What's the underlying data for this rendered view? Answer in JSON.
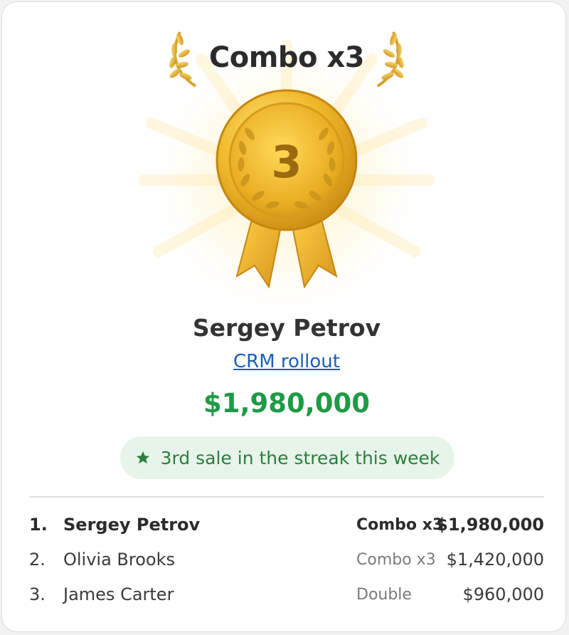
{
  "award": {
    "title": "Combo x3",
    "medal_number": "3",
    "winner_name": "Sergey Petrov",
    "project_link": "CRM rollout",
    "amount": "$1,980,000",
    "streak_message": "3rd sale in the streak this week"
  },
  "colors": {
    "accent_green": "#1f9a47",
    "pill_background": "#e7f4ea",
    "link_blue": "#1a5fb4",
    "gold": "#e7b52a"
  },
  "icons": {
    "medal": "gold-medal-icon",
    "laurel_left": "laurel-left-icon",
    "laurel_right": "laurel-right-icon",
    "star": "star-icon"
  },
  "leaderboard": [
    {
      "rank": "1.",
      "name": "Sergey Petrov",
      "type": "Combo x3",
      "value": "$1,980,000"
    },
    {
      "rank": "2.",
      "name": "Olivia Brooks",
      "type": "Combo x3",
      "value": "$1,420,000"
    },
    {
      "rank": "3.",
      "name": "James Carter",
      "type": "Double",
      "value": "$960,000"
    }
  ]
}
